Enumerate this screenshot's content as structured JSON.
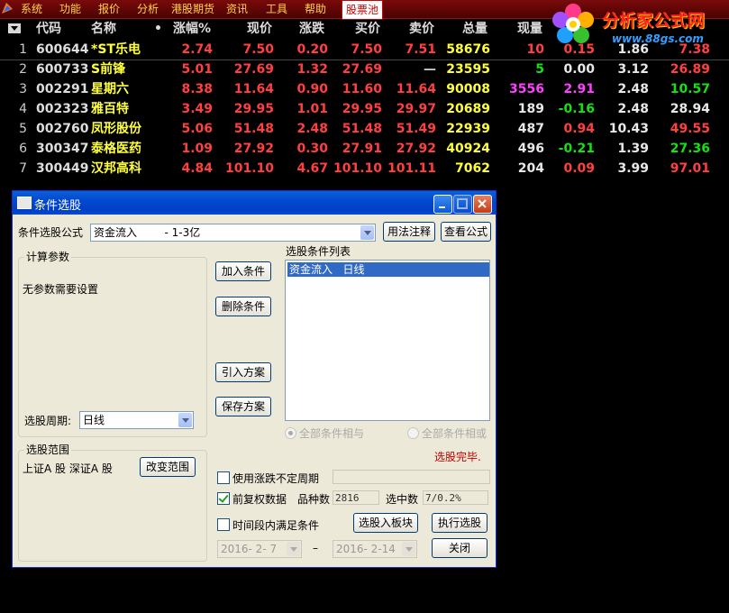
{
  "menu": {
    "items": [
      "系统",
      "功能",
      "报价",
      "分析",
      "港股期货",
      "资讯",
      "工具",
      "帮助",
      "股票池"
    ],
    "active_index": 8
  },
  "brand": {
    "title": "分析家公式网",
    "url": "www.88gs.com"
  },
  "table": {
    "headers": [
      "代码",
      "名称",
      "•",
      "涨幅%",
      "现价",
      "涨跌",
      "买价",
      "卖价",
      "总量",
      "现量"
    ],
    "rows": [
      {
        "idx": "1",
        "code": "600644",
        "name": "*ST乐电",
        "pct": "2.74",
        "price": "7.50",
        "chg": "0.20",
        "bid": "7.50",
        "ask": "7.51",
        "vol": "58676",
        "cur": "10",
        "c11": "0.15",
        "c12": "1.86",
        "c13": "7.38"
      },
      {
        "idx": "2",
        "code": "600733",
        "name": "S前锋",
        "pct": "5.01",
        "price": "27.69",
        "chg": "1.32",
        "bid": "27.69",
        "ask": "—",
        "vol": "23595",
        "cur": "5",
        "c11": "0.00",
        "c12": "3.12",
        "c13": "26.89"
      },
      {
        "idx": "3",
        "code": "002291",
        "name": "星期六",
        "pct": "8.38",
        "price": "11.64",
        "chg": "0.90",
        "bid": "11.60",
        "ask": "11.64",
        "vol": "90008",
        "cur": "3556",
        "c11": "2.91",
        "c12": "2.48",
        "c13": "10.57"
      },
      {
        "idx": "4",
        "code": "002323",
        "name": "雅百特",
        "pct": "3.49",
        "price": "29.95",
        "chg": "1.01",
        "bid": "29.95",
        "ask": "29.97",
        "vol": "20689",
        "cur": "189",
        "c11": "-0.16",
        "c12": "2.48",
        "c13": "28.94"
      },
      {
        "idx": "5",
        "code": "002760",
        "name": "凤形股份",
        "pct": "5.06",
        "price": "51.48",
        "chg": "2.48",
        "bid": "51.48",
        "ask": "51.49",
        "vol": "22939",
        "cur": "487",
        "c11": "0.94",
        "c12": "10.43",
        "c13": "49.55"
      },
      {
        "idx": "6",
        "code": "300347",
        "name": "泰格医药",
        "pct": "1.09",
        "price": "27.92",
        "chg": "0.30",
        "bid": "27.91",
        "ask": "27.92",
        "vol": "40924",
        "cur": "496",
        "c11": "-0.21",
        "c12": "1.39",
        "c13": "27.36"
      },
      {
        "idx": "7",
        "code": "300449",
        "name": "汉邦高科",
        "pct": "4.84",
        "price": "101.10",
        "chg": "4.67",
        "bid": "101.10",
        "ask": "101.11",
        "vol": "7062",
        "cur": "204",
        "c11": "0.09",
        "c12": "3.99",
        "c13": "97.01"
      }
    ]
  },
  "dialog": {
    "title": "条件选股",
    "formula_label": "条件选股公式",
    "formula_value": "资金流入        - 1-3亿",
    "usage_button": "用法注释",
    "view_button": "查看公式",
    "params_group": "计算参数",
    "params_text": "无参数需要设置",
    "period_label": "选股周期:",
    "period_value": "日线",
    "add_button": "加入条件",
    "delete_button": "删除条件",
    "import_button": "引入方案",
    "save_button": "保存方案",
    "list_title": "选股条件列表",
    "list_items": [
      "资金流入   日线"
    ],
    "radio_and": "全部条件相与",
    "radio_or": "全部条件相或",
    "status": "选股完毕.",
    "range_group": "选股范围",
    "range_text": "上证A 股 深证A 股",
    "change_range_button": "改变范围",
    "chk_uncertain": "使用涨跌不定周期",
    "chk_adjust": "前复权数据",
    "count_label": "品种数",
    "count_value": "2816",
    "selected_label": "选中数",
    "selected_value": "7/0.2%",
    "chk_time": "时间段内满足条件",
    "to_block_button": "选股入板块",
    "execute_button": "执行选股",
    "date_from": "2016- 2- 7",
    "date_sep": "–",
    "date_to": "2016- 2-14",
    "close_button": "关闭"
  },
  "colors": {
    "up": "#ff4040",
    "down": "#18e018",
    "name": "#ffff3c",
    "dialog_bg": "#ece9d8",
    "title_bar": "#0348d0",
    "status": "#c00000"
  }
}
